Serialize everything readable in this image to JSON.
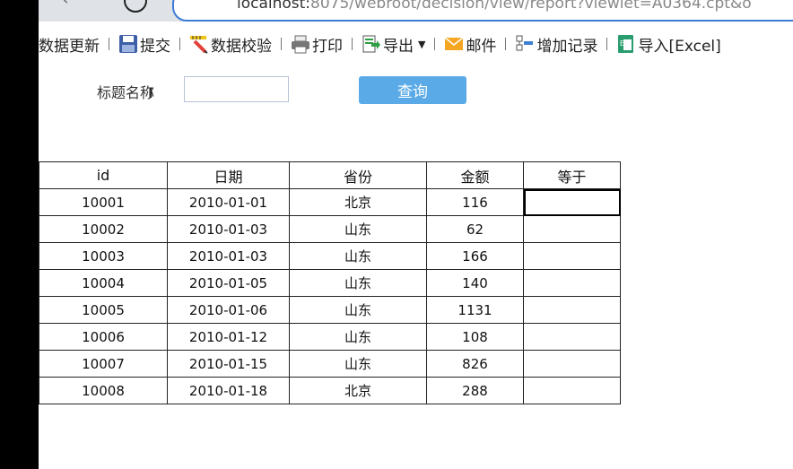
{
  "browser": {
    "url_prefix": "localhost:",
    "url_rest": "8075/webroot/decision/view/report?viewlet=A0364.cpt&o"
  },
  "toolbar": {
    "items": [
      {
        "label": "数据更新",
        "icon": "refresh"
      },
      {
        "label": "提交",
        "icon": "floppy-disk-icon"
      },
      {
        "label": "数据校验",
        "icon": "pencil-ruler-icon"
      },
      {
        "label": "打印",
        "icon": "printer-icon"
      },
      {
        "label": "导出",
        "icon": "export-icon"
      },
      {
        "label": "邮件",
        "icon": "mail-icon"
      },
      {
        "label": "增加记录",
        "icon": "add-record-icon"
      },
      {
        "label": "导入[Excel]",
        "icon": "excel-icon"
      }
    ]
  },
  "form": {
    "title_label": "标题名称",
    "title_value": "",
    "query_button": "查询"
  },
  "table": {
    "headers": [
      "id",
      "日期",
      "省份",
      "金额",
      "等于"
    ],
    "rows": [
      [
        "10001",
        "2010-01-01",
        "北京",
        "116",
        ""
      ],
      [
        "10002",
        "2010-01-03",
        "山东",
        "62",
        ""
      ],
      [
        "10003",
        "2010-01-03",
        "山东",
        "166",
        ""
      ],
      [
        "10004",
        "2010-01-05",
        "山东",
        "140",
        ""
      ],
      [
        "10005",
        "2010-01-06",
        "山东",
        "1131",
        ""
      ],
      [
        "10006",
        "2010-01-12",
        "山东",
        "108",
        ""
      ],
      [
        "10007",
        "2010-01-15",
        "山东",
        "826",
        ""
      ],
      [
        "10008",
        "2010-01-18",
        "北京",
        "288",
        ""
      ]
    ]
  },
  "colors": {
    "query_button": "#5aaae8",
    "url_border": "#3b7bd4"
  }
}
